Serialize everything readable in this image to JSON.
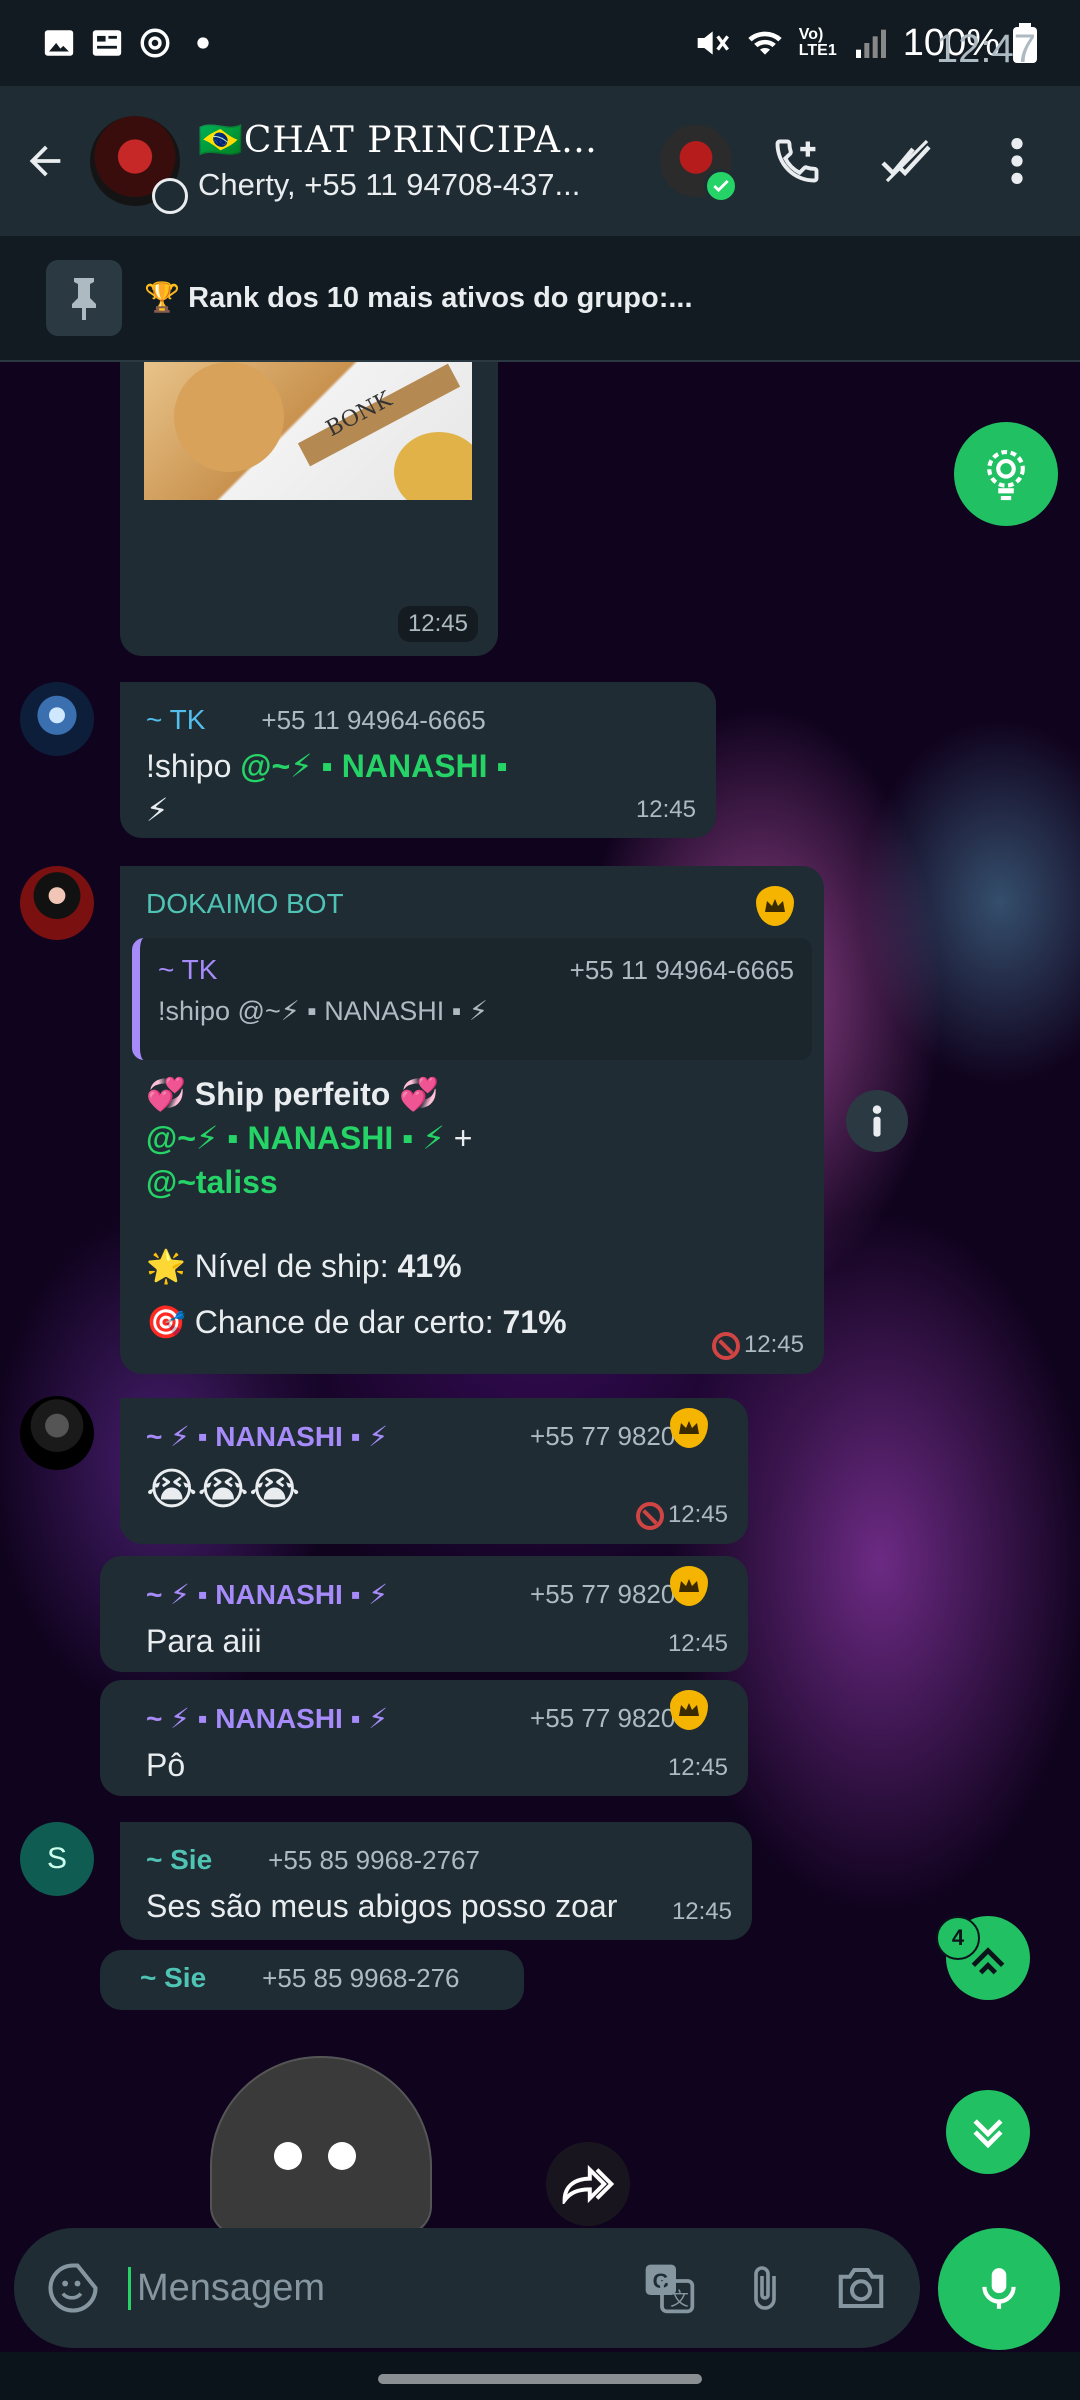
{
  "status_bar": {
    "time": "12:47",
    "battery": "100%",
    "network": "Vo) LTE1"
  },
  "header": {
    "title": "🇧🇷CHAT PRINCIPAL:...",
    "subtitle": "Cherty, +55 11 94708-437..."
  },
  "pinned": {
    "text": "🏆 Rank dos 10 mais ativos do grupo:..."
  },
  "messages": {
    "m0": {
      "image_caption": "BONK",
      "time": "12:45"
    },
    "m1": {
      "sender": "~ TK",
      "phone": "+55 11 94964-6665",
      "text_cmd": "!shipo ",
      "text_mention": "@~⚡ ▪ NANASHI ▪",
      "text_tail": "⚡",
      "time": "12:45"
    },
    "m2": {
      "sender": "DOKAIMO BOT",
      "quote_sender": "~ TK",
      "quote_phone": "+55 11 94964-6665",
      "quote_text": "!shipo @~⚡ ▪ NANASHI ▪ ⚡",
      "line1": "💞 Ship perfeito 💞",
      "line2_mention": "@~⚡ ▪ NANASHI ▪ ⚡",
      "line2_plus": " +",
      "line3_mention": "@~taliss",
      "line4_label": "🌟 Nível de ship: ",
      "line4_value": "41%",
      "line5_label": "🎯 Chance de dar certo: ",
      "line5_value": "71%",
      "time": "12:45"
    },
    "m3": {
      "sender": "~ ⚡ ▪ NANASHI ▪ ⚡",
      "phone": "+55 77 9820-",
      "text": "😭😭😭",
      "time": "12:45"
    },
    "m4": {
      "sender": "~ ⚡ ▪ NANASHI ▪ ⚡",
      "phone": "+55 77 9820-",
      "text": "Para aiii",
      "time": "12:45"
    },
    "m5": {
      "sender": "~ ⚡ ▪ NANASHI ▪ ⚡",
      "phone": "+55 77 9820-",
      "text": "Pô",
      "time": "12:45"
    },
    "m6": {
      "avatar_letter": "S",
      "sender": "~ Sie",
      "phone": "+55 85 9968-2767",
      "text": "Ses são meus abigos posso zoar",
      "time": "12:45"
    },
    "m7": {
      "sender": "~ Sie",
      "phone": "+55 85 9968-276"
    }
  },
  "fabs": {
    "mentions_count": "4"
  },
  "input": {
    "placeholder": "Mensagem"
  },
  "colors": {
    "accent": "#25d366",
    "bubble": "#1f2c34",
    "header": "#1f2c34"
  }
}
